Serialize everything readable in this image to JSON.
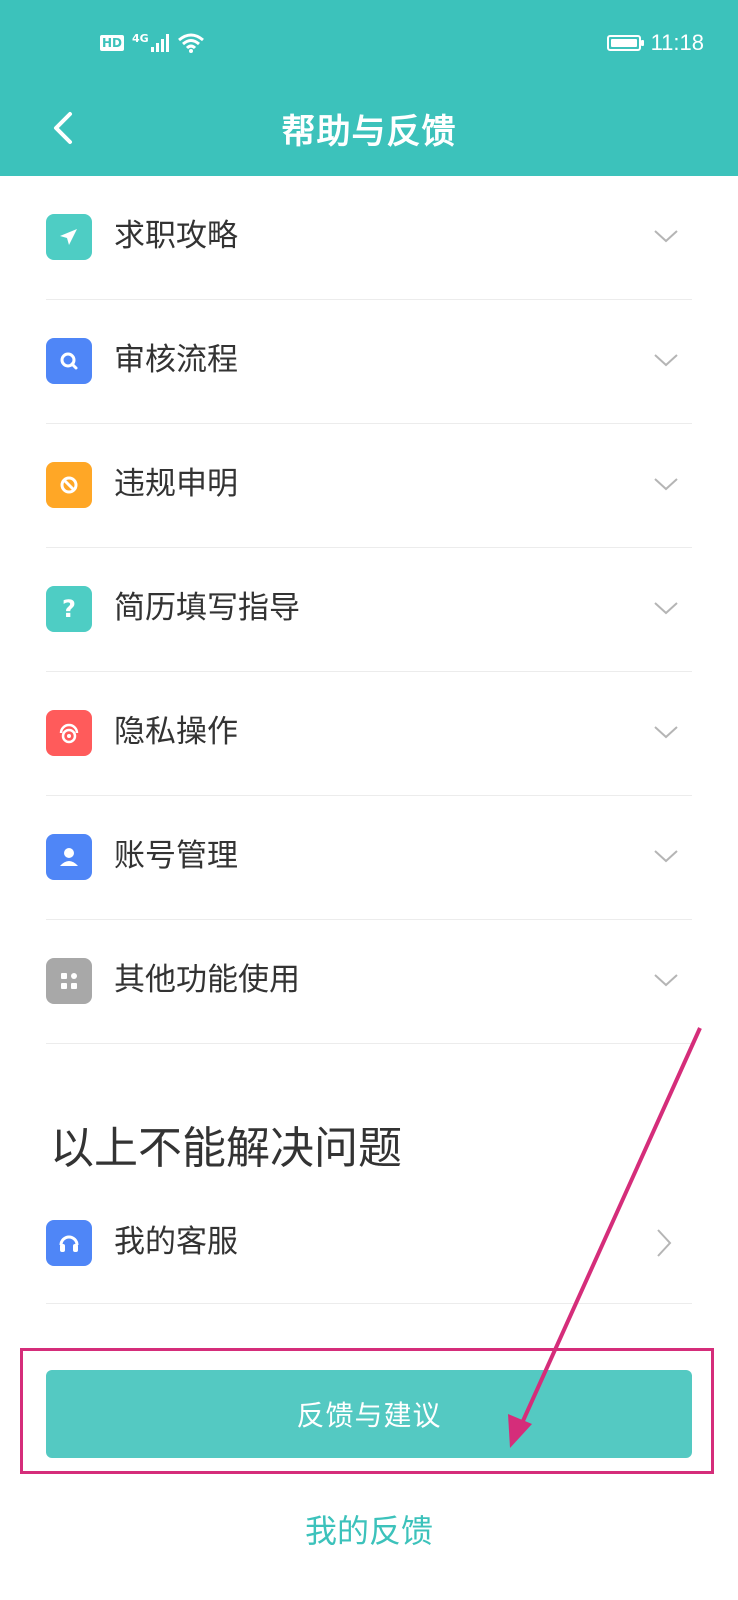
{
  "status_bar": {
    "network": "4G",
    "hd": "HD",
    "time": "11:18"
  },
  "header": {
    "title": "帮助与反馈"
  },
  "help_items": [
    {
      "label": "求职攻略",
      "icon": "send-icon",
      "color": "#4ecdc4"
    },
    {
      "label": "审核流程",
      "icon": "search-icon",
      "color": "#4f86f7"
    },
    {
      "label": "违规申明",
      "icon": "ban-icon",
      "color": "#ffa726"
    },
    {
      "label": "简历填写指导",
      "icon": "question-icon",
      "color": "#4ecdc4"
    },
    {
      "label": "隐私操作",
      "icon": "privacy-icon",
      "color": "#ff5b5b"
    },
    {
      "label": "账号管理",
      "icon": "user-icon",
      "color": "#4f86f7"
    },
    {
      "label": "其他功能使用",
      "icon": "apps-icon",
      "color": "#a8a8a8"
    }
  ],
  "unresolved": {
    "title": "以上不能解决问题",
    "service_label": "我的客服"
  },
  "actions": {
    "feedback_button": "反馈与建议",
    "my_feedback": "我的反馈"
  },
  "colors": {
    "primary": "#3cc2bb",
    "button": "#54c9c2",
    "annotation": "#d52d7a"
  }
}
